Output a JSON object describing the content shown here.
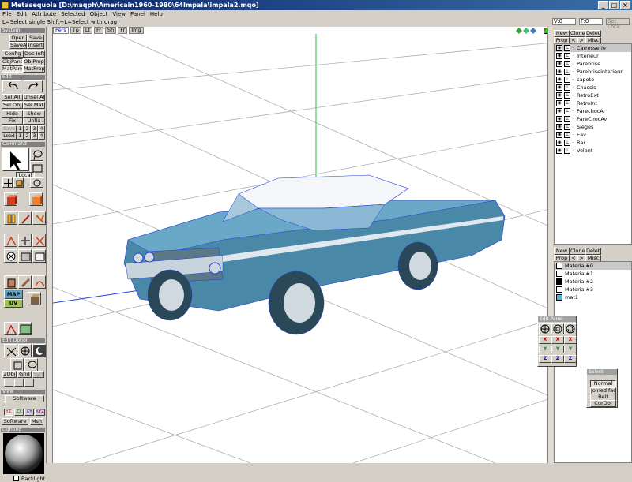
{
  "window": {
    "title": "Metasequoia [D:\\maqph\\Americain1960-1980\\64Impala\\impala2.mqo]",
    "controls": [
      "_",
      "□",
      "×"
    ]
  },
  "menu": [
    "File",
    "Edit",
    "Attribute",
    "Selected",
    "Object",
    "View",
    "Panel",
    "Help"
  ],
  "status": "L=Select single  Shift+L=Select with drag",
  "coords": {
    "v": "V:0",
    "f": "F:0",
    "lastlock": "Set Lock"
  },
  "left": {
    "system_header": "System",
    "open": "Open",
    "save": "Save",
    "saveas": "SaveAs",
    "insert": "Insert",
    "config": "Config",
    "docinfo": "Doc Info",
    "objpanel": "ObjPanel",
    "objprop": "ObjProp",
    "matpanel": "MatPanel",
    "matprop": "MatProp",
    "edit_header": "Edit",
    "selall": "Sel All",
    "unselall": "Unsel All",
    "selobj": "Sel Obj",
    "selmat": "Sel Mat",
    "hide": "Hide",
    "show": "Show",
    "fix": "Fix",
    "unfix": "Unfix",
    "save_label": "Save",
    "load_label": "Load",
    "nums": [
      "1",
      "2",
      "3",
      "4"
    ],
    "command_header": "Command",
    "local": "Local",
    "map": "MAP",
    "uv": "UV",
    "editoption_header": "Edit Option",
    "obj2": "2Obj",
    "grid": "Grid",
    "sym": "Sym",
    "view_header": "View",
    "software": "Software",
    "axes": [
      "YZ",
      "ZX",
      "XY",
      "XYZ"
    ],
    "software2": "Software",
    "mesh": "Msh",
    "lighting_header": "Lighting",
    "backlight": "Backlight"
  },
  "viewport": {
    "tabs": [
      "Pers",
      "Tp",
      "Lt",
      "Fr",
      "Sh",
      "Fr",
      "Img"
    ]
  },
  "objects": {
    "new": "New",
    "clone": "Clone",
    "delete": "Delete",
    "prop": "Prop",
    "prev": "<",
    "next": ">",
    "misc": "Misc",
    "items": [
      "Carrosserie",
      "Interieur",
      "Parebrise",
      "Parebriseinterieur",
      "capote",
      "Chassis",
      "RetroExt",
      "RetroInt",
      "ParechocAr",
      "PareChocAv",
      "Sieges",
      "Eav",
      "Rar",
      "Volant"
    ]
  },
  "materials": {
    "new": "New",
    "clone": "Clone",
    "delete": "Delete",
    "prop": "Prop",
    "prev": "<",
    "next": ">",
    "misc": "Misc",
    "items": [
      {
        "name": "Material#0",
        "color": "#ffffff"
      },
      {
        "name": "Material#1",
        "color": "#ffffff"
      },
      {
        "name": "Material#2",
        "color": "#000000"
      },
      {
        "name": "Material#3",
        "color": "#ffffff"
      },
      {
        "name": "mat1",
        "color": "#5ab4d8"
      }
    ]
  },
  "editpanel": {
    "title": "Edit Panel",
    "x": "X",
    "y": "Y",
    "z": "Z"
  },
  "select": {
    "title": "Select",
    "options": [
      "Normal",
      "Joined face",
      "Belt",
      "CurObj"
    ]
  },
  "colors": {
    "accent": "#0a246a",
    "car": "#4a88a8",
    "wire": "#1e3cdc"
  }
}
